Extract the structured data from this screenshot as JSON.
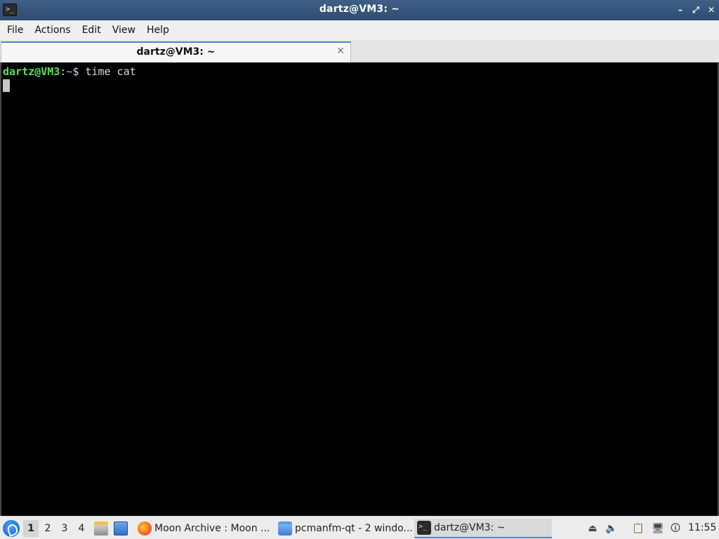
{
  "window": {
    "title": "dartz@VM3: ~",
    "app_icon": "terminal-icon",
    "controls": {
      "minimize": "–",
      "maximize": "⤢",
      "close": "✕"
    }
  },
  "menubar": {
    "items": [
      "File",
      "Actions",
      "Edit",
      "View",
      "Help"
    ]
  },
  "tabs": [
    {
      "label": "dartz@VM3: ~",
      "close": "✕",
      "active": true
    }
  ],
  "terminal": {
    "prompt_user": "dartz@VM3",
    "prompt_sep": ":",
    "prompt_path": "~",
    "prompt_symbol": "$ ",
    "command": "time cat"
  },
  "taskbar": {
    "start_icon": "lxqt-menu-icon",
    "desktops": [
      "1",
      "2",
      "3",
      "4"
    ],
    "active_desktop": "1",
    "quick_launch": [
      "file-manager-icon",
      "show-desktop-icon"
    ],
    "tasks": [
      {
        "label": "Moon Archive : Moon ...",
        "icon": "firefox-icon",
        "active": false
      },
      {
        "label": "pcmanfm-qt - 2 windo...",
        "icon": "folder-icon",
        "active": false
      },
      {
        "label": "dartz@VM3: ~",
        "icon": "terminal-icon",
        "active": true
      }
    ],
    "tray": [
      "eject-icon",
      "volume-icon",
      "clipboard-icon",
      "network-icon",
      "update-notifier-icon"
    ],
    "clock": "11:55"
  }
}
